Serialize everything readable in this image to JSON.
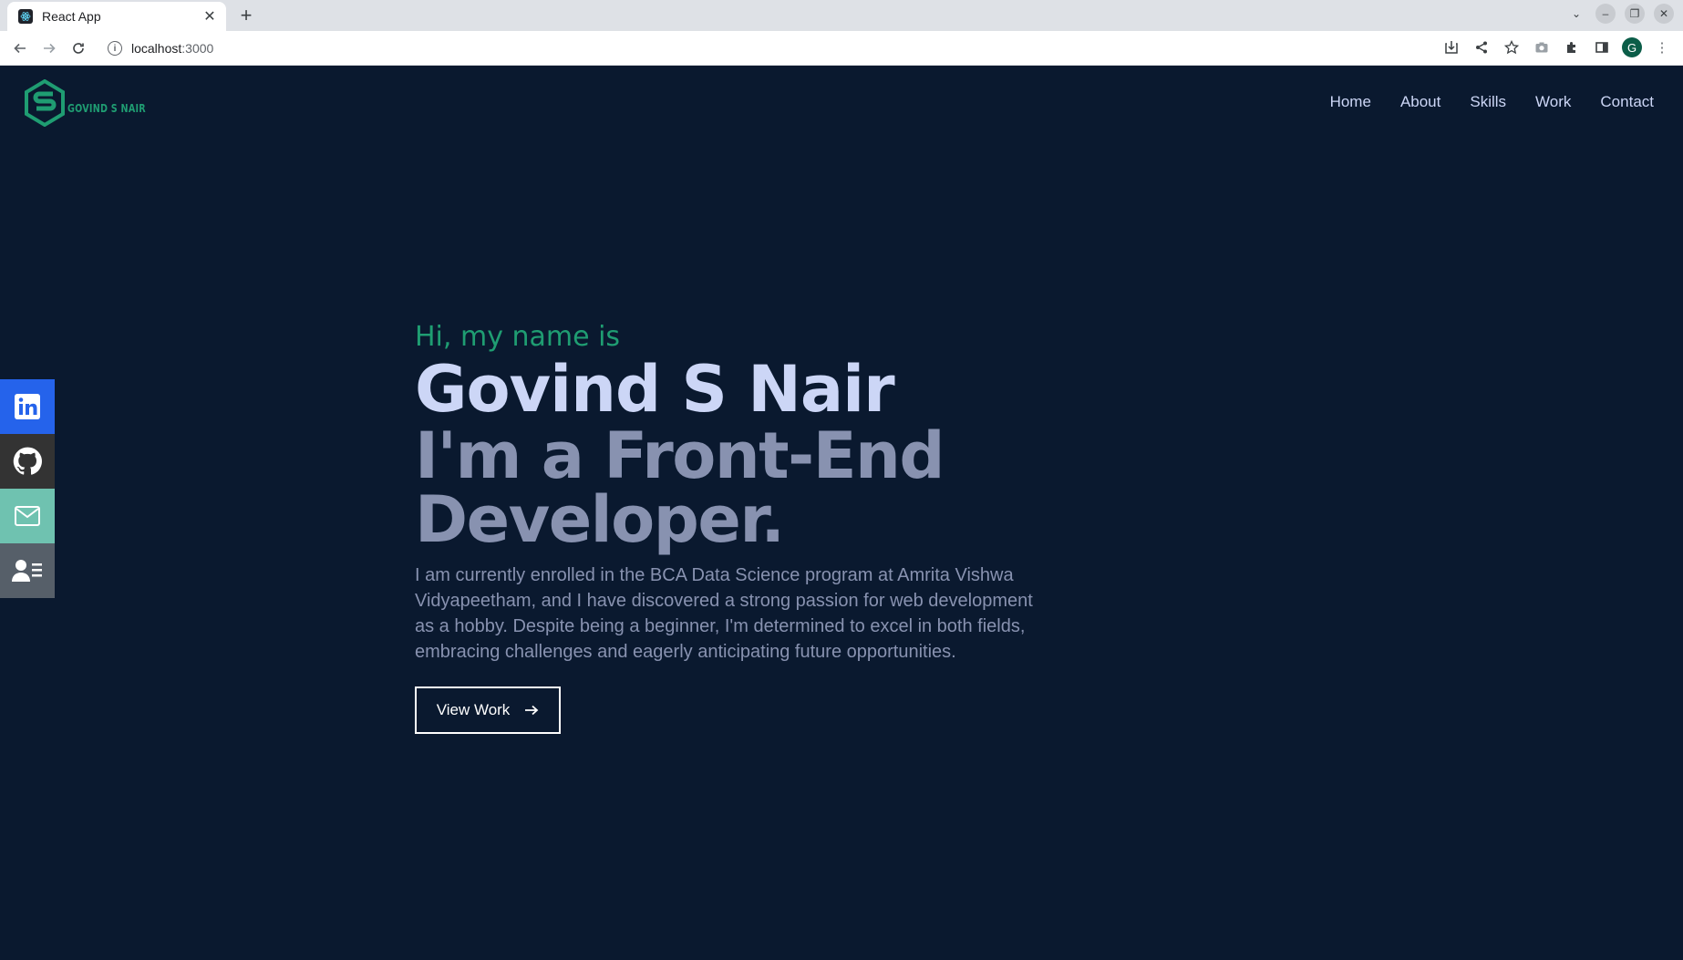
{
  "browser": {
    "tab_title": "React App",
    "url_host": "localhost",
    "url_port": ":3000"
  },
  "site": {
    "logo_text": "GOVIND S NAIR",
    "nav": [
      {
        "label": "Home"
      },
      {
        "label": "About"
      },
      {
        "label": "Skills"
      },
      {
        "label": "Work"
      },
      {
        "label": "Contact"
      }
    ],
    "social": [
      {
        "name": "linkedin-icon",
        "color": "#2563eb"
      },
      {
        "name": "github-icon",
        "color": "#333333"
      },
      {
        "name": "mail-icon",
        "color": "#6fc2b0"
      },
      {
        "name": "resume-icon",
        "color": "#565f69"
      }
    ]
  },
  "hero": {
    "intro": "Hi, my name is",
    "name": "Govind S Nair",
    "role": "I'm a Front-End Developer.",
    "bio": "I am currently enrolled in the BCA Data Science program at Amrita Vishwa Vidyapeetham, and I have discovered a strong passion for web development as a hobby. Despite being a beginner, I'm determined to excel in both fields, embracing challenges and eagerly anticipating future opportunities.",
    "cta_label": "View Work"
  },
  "colors": {
    "background": "#0a192f",
    "accent": "#1f9d72",
    "primary_text": "#ccd6f6",
    "secondary_text": "#8892b0"
  }
}
